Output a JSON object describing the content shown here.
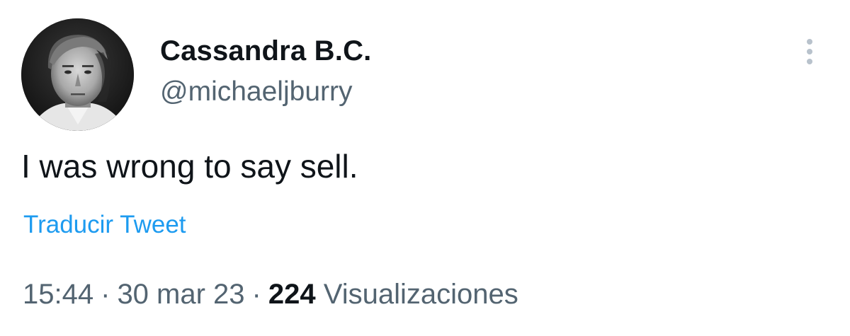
{
  "author": {
    "display_name": "Cassandra B.C.",
    "handle": "@michaeljburry"
  },
  "tweet": {
    "text": "I was wrong to say sell.",
    "translate_label": "Traducir Tweet"
  },
  "meta": {
    "time": "15:44",
    "separator": "·",
    "date": "30 mar 23",
    "views_count": "224",
    "views_label": "Visualizaciones"
  },
  "colors": {
    "text_primary": "#0f1419",
    "text_secondary": "#536471",
    "link": "#1d9bf0",
    "more_dots": "#b8c2cc"
  },
  "icons": {
    "more": "more-vertical-icon"
  }
}
